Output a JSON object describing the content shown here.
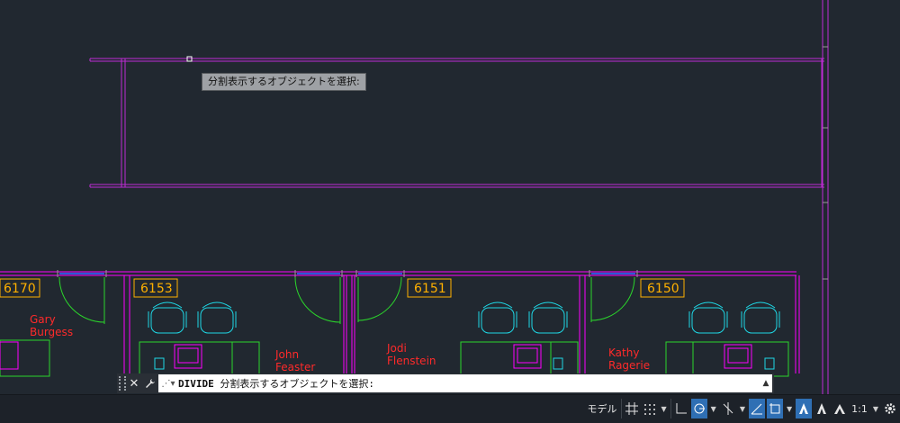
{
  "tooltip": {
    "text": "分割表示するオブジェクトを選択:"
  },
  "rooms": [
    {
      "number": "6170",
      "occupant": [
        "Gary",
        "Burgess"
      ]
    },
    {
      "number": "6153",
      "occupant": [
        "John",
        "Feaster"
      ]
    },
    {
      "number": "6151",
      "occupant": [
        "Jodi",
        "Flenstein"
      ]
    },
    {
      "number": "6150",
      "occupant": [
        "Kathy",
        "Ragerie"
      ]
    }
  ],
  "command_line": {
    "command": "DIVIDE",
    "prompt": "分割表示するオブジェクトを選択:",
    "close_icon": "close-icon",
    "customize_icon": "wrench-icon"
  },
  "status_bar": {
    "model_label": "モデル",
    "scale_label": "1:1"
  },
  "colors": {
    "background": "#212830",
    "selection": "#c02bd6",
    "rooms": "#ff00ff",
    "tags": "#ffb000",
    "names": "#ff2a2a",
    "furniture": "#1ed8e6",
    "desks": "#2bd62b",
    "windows": "#2a5bd7",
    "accent": "#2f6fb4"
  }
}
